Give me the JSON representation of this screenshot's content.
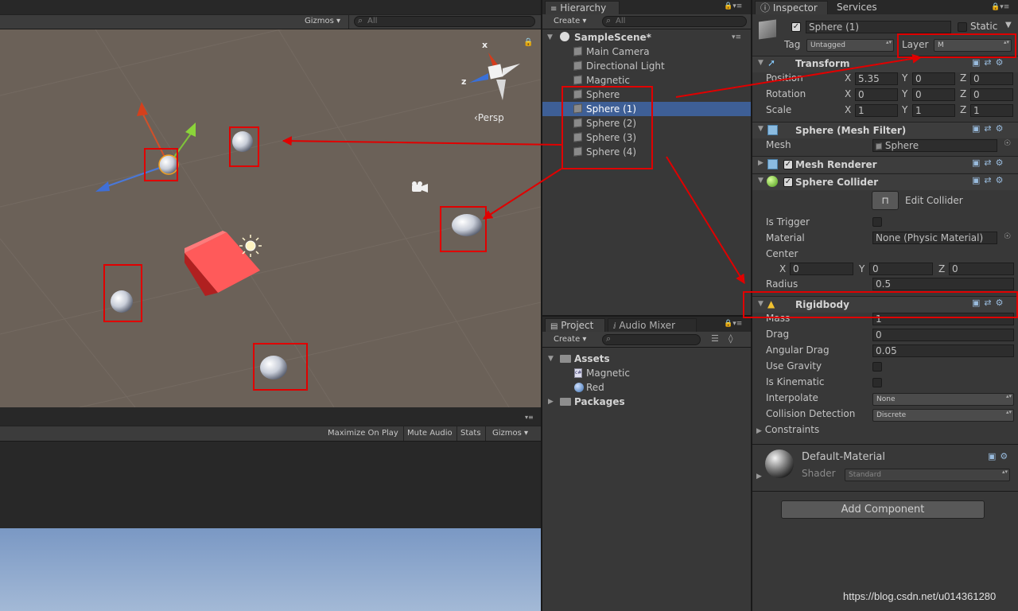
{
  "scene": {
    "gizmos_label": "Gizmos",
    "search_placeholder": "All",
    "persp_label": "‹Persp",
    "axis_x": "x",
    "axis_z": "z"
  },
  "game": {
    "maximize_on_play": "Maximize On Play",
    "mute_audio": "Mute Audio",
    "stats": "Stats",
    "gizmos": "Gizmos"
  },
  "hierarchy": {
    "tab": "Hierarchy",
    "create": "Create",
    "search_placeholder": "All",
    "scene_name": "SampleScene*",
    "items": [
      {
        "label": "Main Camera"
      },
      {
        "label": "Directional Light"
      },
      {
        "label": "Magnetic"
      },
      {
        "label": "Sphere"
      },
      {
        "label": "Sphere (1)",
        "selected": true
      },
      {
        "label": "Sphere (2)"
      },
      {
        "label": "Sphere (3)"
      },
      {
        "label": "Sphere (4)"
      }
    ]
  },
  "project": {
    "tab_project": "Project",
    "tab_audio": "Audio Mixer",
    "create": "Create",
    "assets_label": "Assets",
    "assets": [
      {
        "label": "Magnetic"
      },
      {
        "label": "Red"
      }
    ],
    "packages_label": "Packages"
  },
  "inspector": {
    "tab": "Inspector",
    "services_tab": "Services",
    "object_name": "Sphere (1)",
    "static_label": "Static",
    "tag_label": "Tag",
    "tag_value": "Untagged",
    "layer_label": "Layer",
    "layer_value": "M",
    "transform": {
      "title": "Transform",
      "position_label": "Position",
      "rotation_label": "Rotation",
      "scale_label": "Scale",
      "position": {
        "x": "5.35",
        "y": "0",
        "z": "0"
      },
      "rotation": {
        "x": "0",
        "y": "0",
        "z": "0"
      },
      "scale": {
        "x": "1",
        "y": "1",
        "z": "1"
      }
    },
    "axis": {
      "x": "X",
      "y": "Y",
      "z": "Z"
    },
    "mesh_filter": {
      "title": "Sphere (Mesh Filter)",
      "mesh_label": "Mesh",
      "mesh_value": "Sphere"
    },
    "mesh_renderer": {
      "title": "Mesh Renderer"
    },
    "sphere_collider": {
      "title": "Sphere Collider",
      "edit_collider": "Edit Collider",
      "is_trigger": "Is Trigger",
      "material_label": "Material",
      "material_value": "None (Physic Material)",
      "center_label": "Center",
      "center": {
        "x": "0",
        "y": "0",
        "z": "0"
      },
      "radius_label": "Radius",
      "radius": "0.5"
    },
    "rigidbody": {
      "title": "Rigidbody",
      "mass_label": "Mass",
      "mass": "1",
      "drag_label": "Drag",
      "drag": "0",
      "angular_drag_label": "Angular Drag",
      "angular_drag": "0.05",
      "use_gravity": "Use Gravity",
      "is_kinematic": "Is Kinematic",
      "interpolate_label": "Interpolate",
      "interpolate": "None",
      "collision_label": "Collision Detection",
      "collision": "Discrete",
      "constraints": "Constraints"
    },
    "material": {
      "name": "Default-Material",
      "shader_label": "Shader",
      "shader": "Standard"
    },
    "add_component": "Add Component"
  },
  "watermark": "https://blog.csdn.net/u014361280",
  "colors": {
    "accent_red": "#e00000",
    "selection": "#3e5f96",
    "scene_bg": "#6b6158"
  }
}
